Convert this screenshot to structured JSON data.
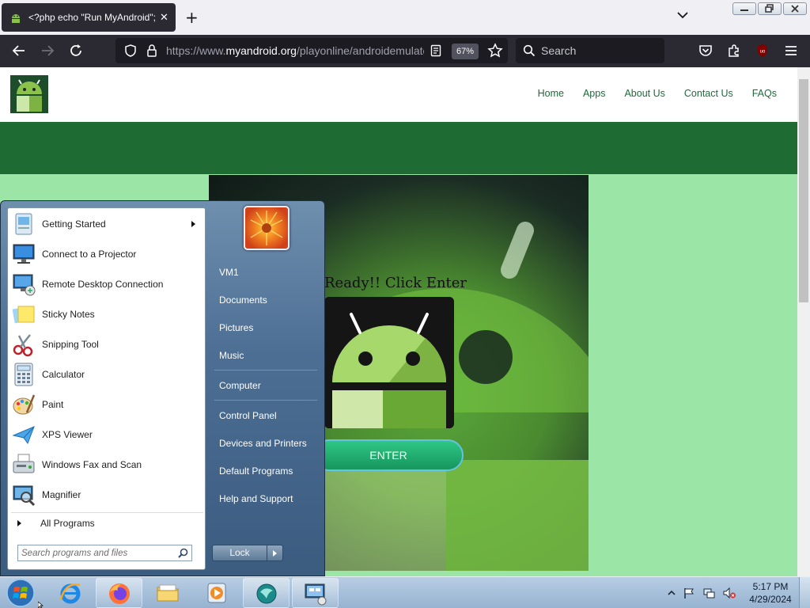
{
  "browser": {
    "tab_title": "<?php echo \"Run MyAndroid\";",
    "url_prefix": "https://www.",
    "url_host": "myandroid.org",
    "url_path": "/playonline/androidemulator",
    "zoom": "67%",
    "search_placeholder": "Search"
  },
  "site": {
    "nav": [
      "Home",
      "Apps",
      "About Us",
      "Contact Us",
      "FAQs"
    ],
    "ready_text": "Ready!! Click Enter",
    "enter_label": "ENTER"
  },
  "start_menu": {
    "programs": [
      {
        "label": "Getting Started",
        "icon": "getting-started-icon",
        "submenu": true
      },
      {
        "label": "Connect to a Projector",
        "icon": "projector-icon"
      },
      {
        "label": "Remote Desktop Connection",
        "icon": "remote-desktop-icon"
      },
      {
        "label": "Sticky Notes",
        "icon": "sticky-notes-icon"
      },
      {
        "label": "Snipping Tool",
        "icon": "snipping-tool-icon"
      },
      {
        "label": "Calculator",
        "icon": "calculator-icon"
      },
      {
        "label": "Paint",
        "icon": "paint-icon"
      },
      {
        "label": "XPS Viewer",
        "icon": "xps-viewer-icon"
      },
      {
        "label": "Windows Fax and Scan",
        "icon": "fax-scan-icon"
      },
      {
        "label": "Magnifier",
        "icon": "magnifier-icon"
      }
    ],
    "all_programs": "All Programs",
    "search_placeholder": "Search programs and files",
    "right_items": [
      "VM1",
      "Documents",
      "Pictures",
      "Music",
      "Computer",
      "Control Panel",
      "Devices and Printers",
      "Default Programs",
      "Help and Support"
    ],
    "lock_label": "Lock"
  },
  "taskbar": {
    "time": "5:17 PM",
    "date": "4/29/2024"
  },
  "colors": {
    "page_bg": "#9be6a6",
    "banner": "#1e6b34",
    "nav_link": "#1e6b3a",
    "browser_dark": "#2b2a33",
    "enter_green": "#17955d"
  }
}
